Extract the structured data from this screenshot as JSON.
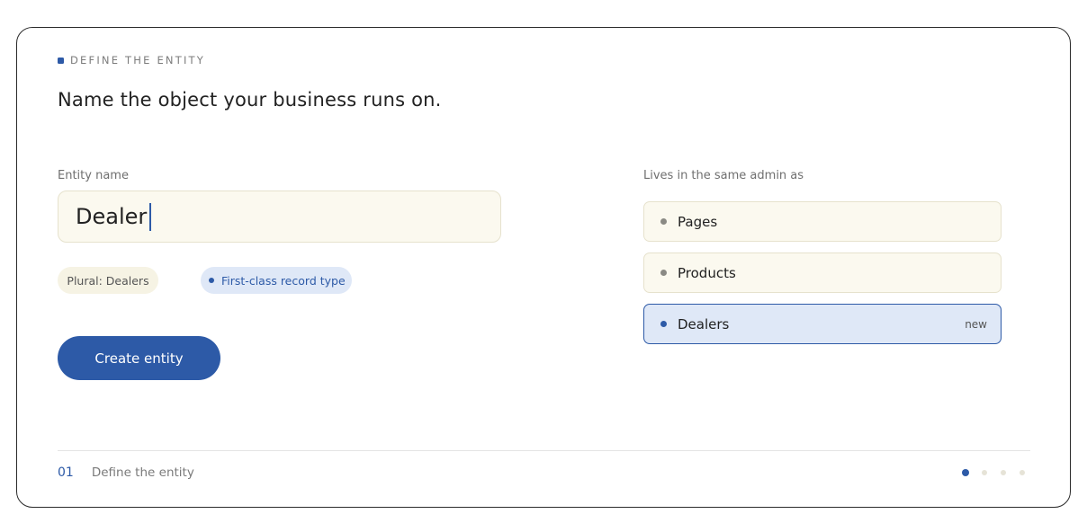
{
  "section": {
    "eyebrow": "DEFINE THE ENTITY",
    "headline": "Name the object your business runs on."
  },
  "entity": {
    "label": "Entity name",
    "value": "Dealer",
    "chips": {
      "plural": "Plural: Dealers",
      "type": "First-class record type"
    },
    "create_label": "Create entity"
  },
  "admin": {
    "label": "Lives in the same admin as",
    "items": [
      {
        "label": "Pages",
        "badge": ""
      },
      {
        "label": "Products",
        "badge": ""
      },
      {
        "label": "Dealers",
        "badge": "new",
        "active": true
      }
    ]
  },
  "footer": {
    "step_number": "01",
    "step_name": "Define the entity",
    "total_steps": 4,
    "current_step": 1
  },
  "colors": {
    "accent": "#2d5aa7",
    "input_bg": "#fbf9ef",
    "active_bg": "#dfe8f7"
  }
}
